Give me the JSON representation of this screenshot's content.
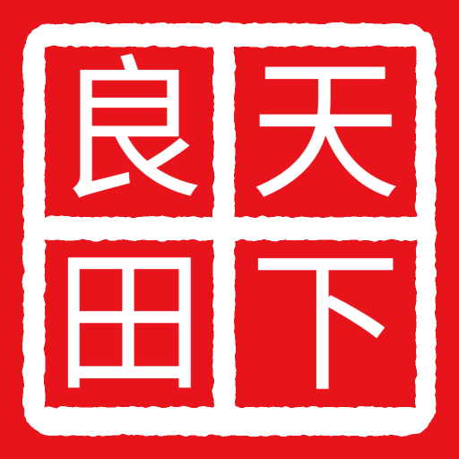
{
  "seal": {
    "characters": {
      "top_left": "良",
      "top_right": "天",
      "bottom_left": "田",
      "bottom_right": "下"
    }
  },
  "colors": {
    "background": "#e8141c",
    "ink": "#ffffff"
  },
  "icons": {
    "seal": "red-seal-stamp-icon"
  }
}
